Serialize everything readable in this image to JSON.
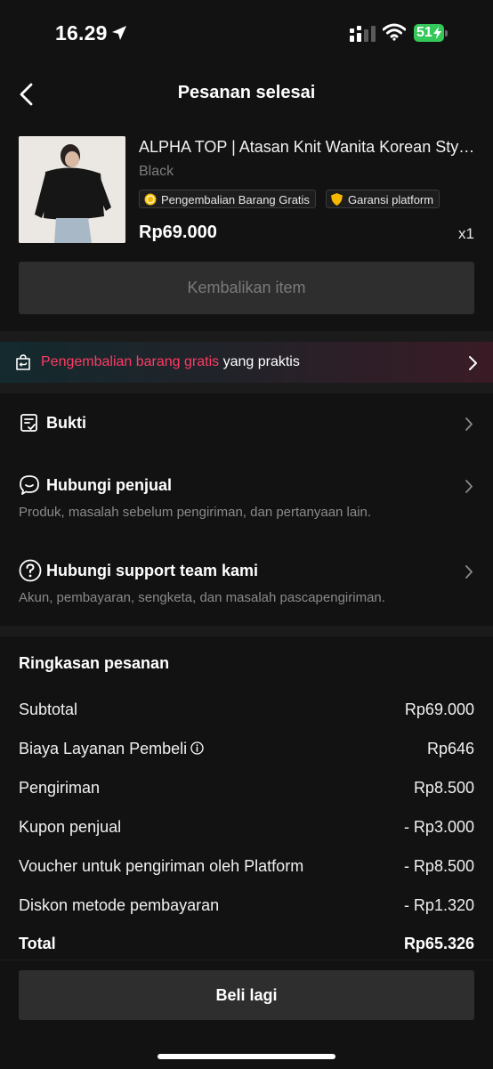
{
  "status_bar": {
    "time": "16.29",
    "battery": "51",
    "icons": [
      "location-arrow-icon",
      "signal-icon",
      "wifi-icon",
      "battery-charging-icon"
    ]
  },
  "header": {
    "title": "Pesanan selesai",
    "back_icon": "chevron-left-icon"
  },
  "product": {
    "name": "ALPHA TOP | Atasan Knit Wanita Korean Style Lengan Panjang",
    "variant": "Black",
    "tags": [
      "Pengembalian Barang Gratis",
      "Garansi platform"
    ],
    "price": "Rp69.000",
    "quantity": "x1"
  },
  "return_button": "Kembalikan item",
  "banner": {
    "highlight": "Pengembalian barang gratis",
    "text": " yang praktis"
  },
  "menu": [
    {
      "title": "Bukti",
      "subtitle": "",
      "icon": "checklist-icon"
    },
    {
      "title": "Hubungi penjual",
      "subtitle": "Produk, masalah sebelum pengiriman, dan pertanyaan lain.",
      "icon": "chat-bubble-icon"
    },
    {
      "title": "Hubungi support team kami",
      "subtitle": "Akun, pembayaran, sengketa, dan masalah pascapengiriman.",
      "icon": "help-circle-icon"
    }
  ],
  "summary": {
    "title": "Ringkasan pesanan",
    "lines": [
      {
        "label": "Subtotal",
        "value": "Rp69.000"
      },
      {
        "label": "Biaya Layanan Pembeli",
        "value": "Rp646"
      },
      {
        "label": "Pengiriman",
        "value": "Rp8.500"
      },
      {
        "label": "Kupon penjual",
        "value": "- Rp3.000"
      },
      {
        "label": "Voucher untuk pengiriman oleh Platform",
        "value": "- Rp8.500"
      },
      {
        "label": "Diskon metode pembayaran",
        "value": "- Rp1.320"
      }
    ],
    "total": {
      "label": "Total",
      "value": "Rp65.326"
    }
  },
  "buy_again_button": "Beli lagi",
  "colors": {
    "background": "#121212",
    "accent_red": "#fe3b63",
    "battery_green": "#34c759",
    "button_gray": "#2e2e2e"
  }
}
